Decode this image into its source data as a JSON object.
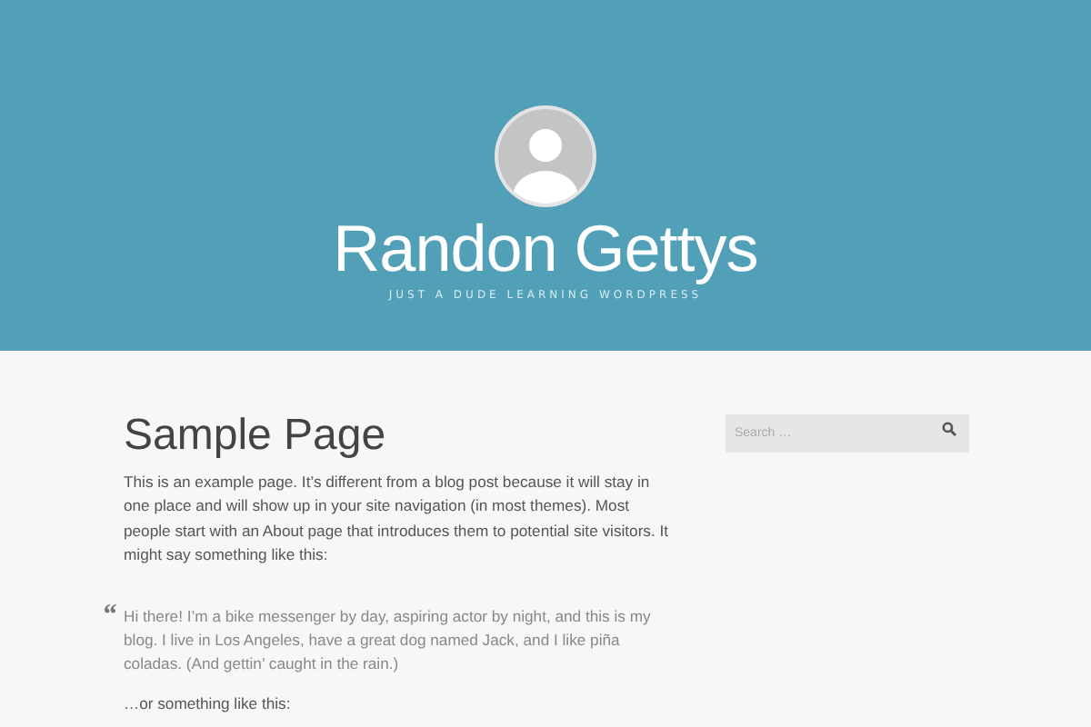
{
  "header": {
    "site_title": "Randon Gettys",
    "tagline": "JUST A DUDE LEARNING WORDPRESS"
  },
  "page": {
    "title": "Sample Page",
    "intro": "This is an example page. It’s different from a blog post because it will stay in one place and will show up in your site navigation (in most themes). Most people start with an About page that introduces them to potential site visitors. It might say something like this:",
    "quote_mark": "“",
    "quote": "Hi there! I’m a bike messenger by day, aspiring actor by night, and this is my blog. I live in Los Angeles, have a great dog named Jack, and I like piña coladas. (And gettin’ caught in the rain.)",
    "outro": "…or something like this:"
  },
  "sidebar": {
    "search": {
      "placeholder": "Search …"
    }
  }
}
